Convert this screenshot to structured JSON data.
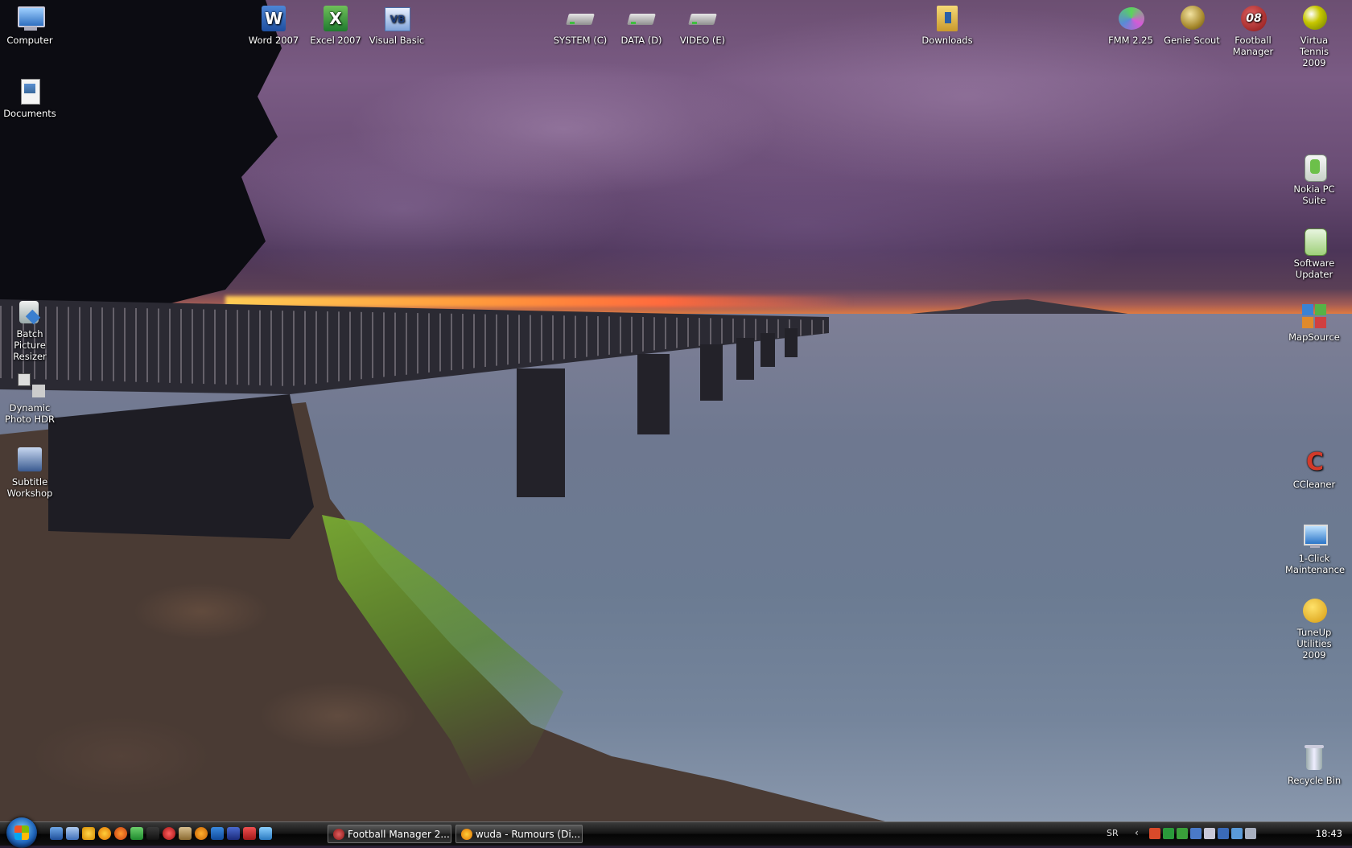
{
  "desktop": {
    "icons_left": [
      {
        "label": "Computer",
        "icon": "computer-icon"
      },
      {
        "label": "Documents",
        "icon": "documents-icon"
      },
      {
        "label": "Batch Picture\nResizer",
        "icon": "batch-picture-resizer-icon"
      },
      {
        "label": "Dynamic\nPhoto HDR",
        "icon": "dynamic-photo-hdr-icon"
      },
      {
        "label": "Subtitle\nWorkshop",
        "icon": "subtitle-workshop-icon"
      }
    ],
    "icons_top": [
      {
        "label": "Word 2007",
        "icon": "word-icon"
      },
      {
        "label": "Excel 2007",
        "icon": "excel-icon"
      },
      {
        "label": "Visual Basic",
        "icon": "visual-basic-icon"
      },
      {
        "label": "SYSTEM (C)",
        "icon": "drive-icon"
      },
      {
        "label": "DATA (D)",
        "icon": "drive-icon"
      },
      {
        "label": "VIDEO (E)",
        "icon": "drive-icon"
      },
      {
        "label": "Downloads",
        "icon": "folder-icon"
      },
      {
        "label": "FMM 2.25",
        "icon": "fmm-icon"
      },
      {
        "label": "Genie Scout",
        "icon": "genie-scout-icon"
      },
      {
        "label": "Football\nManager",
        "icon": "football-manager-icon"
      },
      {
        "label": "Virtua Tennis\n2009",
        "icon": "tennis-ball-icon"
      }
    ],
    "icons_right": [
      {
        "label": "Nokia PC\nSuite",
        "icon": "nokia-pc-suite-icon"
      },
      {
        "label": "Software\nUpdater",
        "icon": "software-updater-icon"
      },
      {
        "label": "MapSource",
        "icon": "mapsource-icon"
      },
      {
        "label": "CCleaner",
        "icon": "ccleaner-icon"
      },
      {
        "label": "1-Click\nMaintenance",
        "icon": "maintenance-icon"
      },
      {
        "label": "TuneUp\nUtilities 2009",
        "icon": "tuneup-icon"
      },
      {
        "label": "Recycle Bin",
        "icon": "recycle-bin-icon"
      }
    ]
  },
  "taskbar": {
    "start_icon": "windows-logo-icon",
    "quicklaunch": [
      "show-desktop-icon",
      "switch-windows-icon",
      "app-icon",
      "browser-icon",
      "firefox-icon",
      "app-icon",
      "app-icon",
      "app-icon",
      "app-icon",
      "app-icon",
      "app-icon",
      "app-icon",
      "app-icon",
      "app-icon"
    ],
    "tasks": [
      {
        "label": "Football Manager 2...",
        "icon": "football-manager-icon"
      },
      {
        "label": "wuda - Rumours (Di...",
        "icon": "browser-icon"
      }
    ],
    "tray": {
      "language": "SR",
      "time": "18:43"
    }
  },
  "colors": {
    "taskbar": "#141414",
    "icon_text": "#ffffff"
  }
}
